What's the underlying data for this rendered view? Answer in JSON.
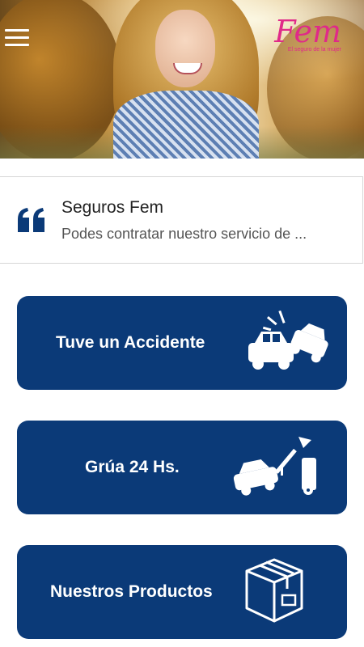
{
  "header": {
    "menu_icon": "hamburger-menu-icon",
    "logo_text": "Fem",
    "logo_tagline": "El seguro de la mujer"
  },
  "news": {
    "title": "Seguros Fem",
    "subtitle": "Podes contratar nuestro servicio de ...",
    "icon": "quote-icon"
  },
  "actions": [
    {
      "label": "Tuve un Accidente",
      "icon": "car-crash-icon"
    },
    {
      "label": "Grúa 24 Hs.",
      "icon": "tow-truck-icon"
    },
    {
      "label": "Nuestros Productos",
      "icon": "box-icon"
    }
  ],
  "colors": {
    "primary": "#0b3a78",
    "brand_pink": "#e02a89",
    "quote_icon": "#0b3a78"
  }
}
